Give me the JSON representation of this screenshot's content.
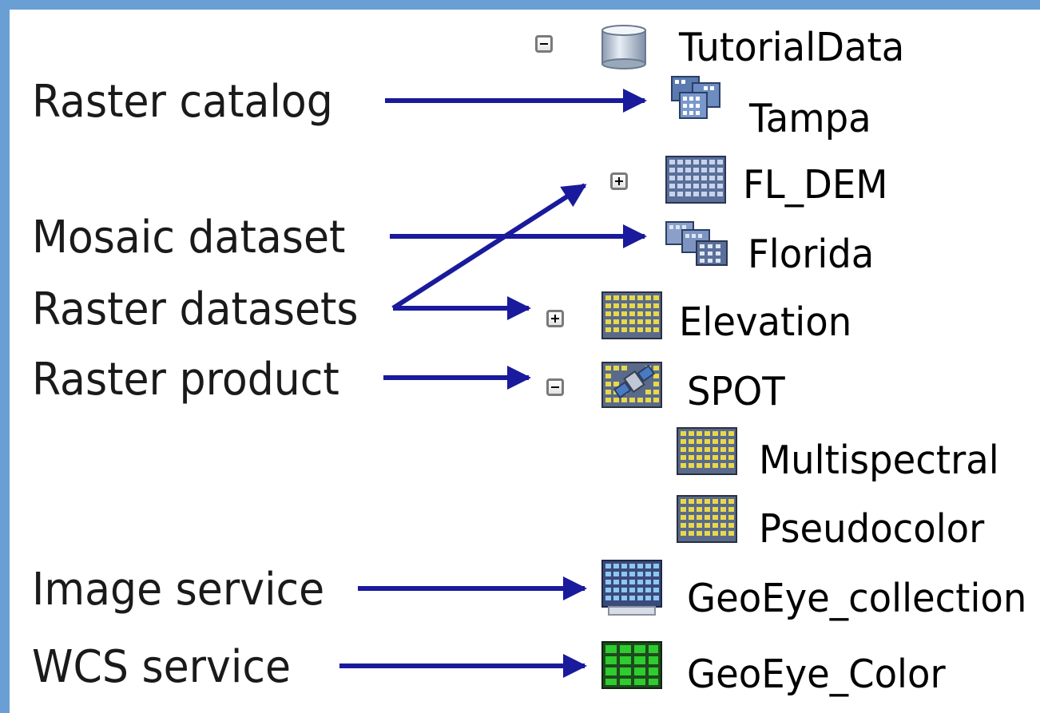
{
  "labels": {
    "raster_catalog": "Raster catalog",
    "mosaic_dataset": "Mosaic dataset",
    "raster_datasets": "Raster datasets",
    "raster_product": "Raster product",
    "image_service": "Image service",
    "wcs_service": "WCS service"
  },
  "tree": {
    "root": "TutorialData",
    "tampa": "Tampa",
    "fl_dem": "FL_DEM",
    "florida": "Florida",
    "elevation": "Elevation",
    "spot": "SPOT",
    "multispectral": "Multispectral",
    "pseudocolor": "Pseudocolor",
    "geoeye_collection": "GeoEye_collection",
    "geoeye_color": "GeoEye_Color"
  },
  "icons": {
    "root": "database-icon",
    "tampa": "raster-catalog-icon",
    "fl_dem": "raster-dataset-icon",
    "florida": "mosaic-dataset-icon",
    "elevation": "raster-dataset-icon",
    "spot": "raster-product-icon",
    "multispectral": "raster-dataset-icon",
    "pseudocolor": "raster-dataset-icon",
    "geoeye_collection": "image-service-icon",
    "geoeye_color": "wcs-service-icon"
  },
  "colors": {
    "arrow": "#1a1a9c",
    "frame": "#6a9fd6",
    "grid_yellow": "#e8d84a",
    "grid_blue": "#8aa6d6",
    "grid_green": "#2ecc2e"
  }
}
